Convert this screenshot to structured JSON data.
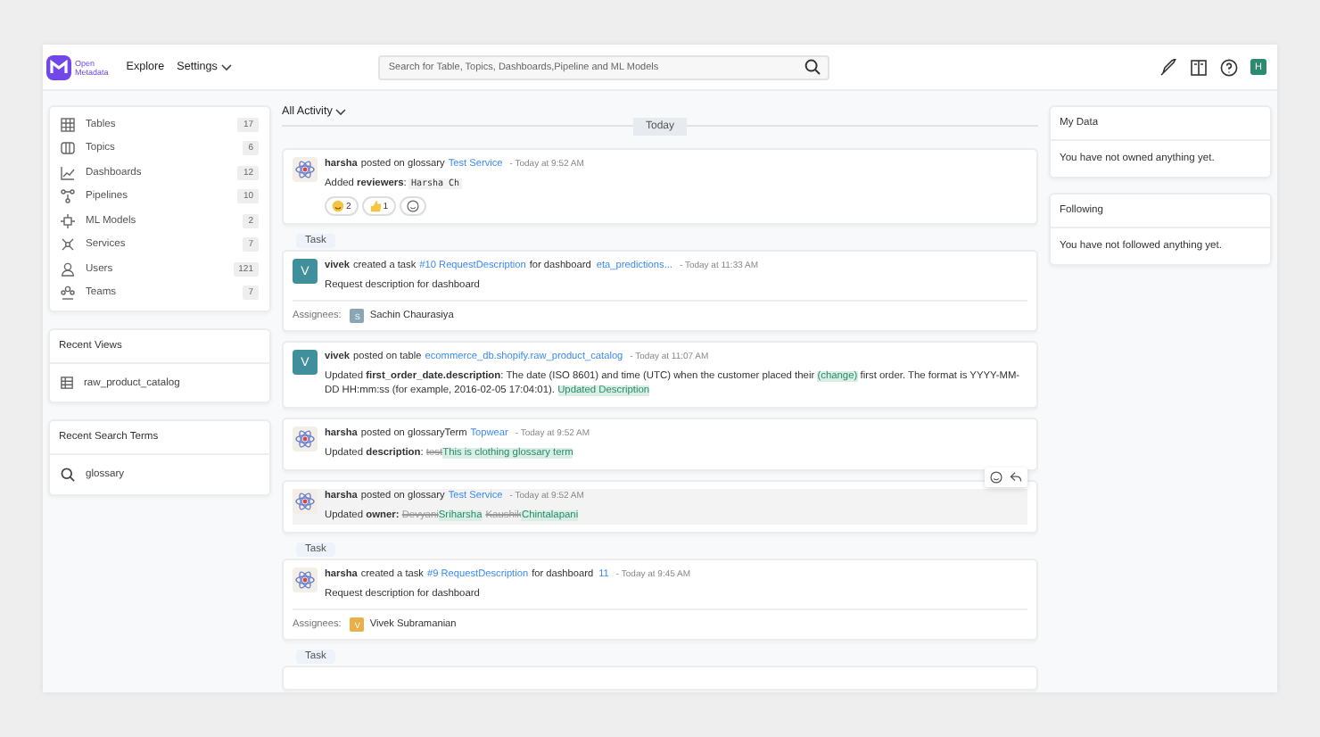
{
  "nav": {
    "logo_text": [
      "Open",
      "Metadata"
    ],
    "links": [
      {
        "label": "Explore",
        "dropdown": false
      },
      {
        "label": "Settings",
        "dropdown": true
      }
    ],
    "search": {
      "placeholder": "Search for Table, Topics, Dashboards,Pipeline and ML Models"
    },
    "user_initial": "H"
  },
  "sidebar": {
    "entities": [
      {
        "label": "Tables",
        "count": "17"
      },
      {
        "label": "Topics",
        "count": "6"
      },
      {
        "label": "Dashboards",
        "count": "12"
      },
      {
        "label": "Pipelines",
        "count": "10"
      },
      {
        "label": "ML Models",
        "count": "2"
      },
      {
        "label": "Services",
        "count": "7"
      },
      {
        "label": "Users",
        "count": "121"
      },
      {
        "label": "Teams",
        "count": "7"
      }
    ],
    "recent_views": {
      "title": "Recent Views",
      "items": [
        "raw_product_catalog"
      ]
    },
    "recent_search": {
      "title": "Recent Search Terms",
      "items": [
        "glossary"
      ]
    }
  },
  "feed": {
    "filter": "All Activity",
    "divider": "Today",
    "items": [
      {
        "kind": "post",
        "hovered": false,
        "avatar": {
          "kind": "logo"
        },
        "author": "harsha",
        "action": "posted on glossary",
        "link": "Test Service",
        "time": "- Today at 9:52 AM",
        "body": [
          {
            "kind": "plain",
            "text": "Added "
          },
          {
            "kind": "bold",
            "text": "reviewers"
          },
          {
            "kind": "plain",
            "text": ": "
          },
          {
            "kind": "code",
            "text": "Harsha Ch"
          }
        ],
        "reactions": [
          {
            "kind": "smile",
            "count": "2"
          },
          {
            "kind": "thumb",
            "count": "1"
          }
        ]
      },
      {
        "kind": "task",
        "badge": "Task",
        "hovered": false,
        "avatar": {
          "kind": "initial",
          "letter": "V",
          "color": "#3f8f9c"
        },
        "author": "vivek",
        "action": "created a task",
        "link": "#10 RequestDescription",
        "extra": "for dashboard",
        "extra_link": "eta_predictions...",
        "time": "- Today at 11:33 AM",
        "body": [
          {
            "kind": "plain",
            "text": "Request description for dashboard"
          }
        ],
        "assignees": {
          "label": "Assignees:",
          "people": [
            {
              "letter": "S",
              "color": "#8aa6b5",
              "name": "Sachin Chaurasiya"
            }
          ]
        }
      },
      {
        "kind": "post",
        "hovered": false,
        "avatar": {
          "kind": "initial",
          "letter": "V",
          "color": "#3f8f9c"
        },
        "author": "vivek",
        "action": "posted on table",
        "link": "ecommerce_db.shopify.raw_product_catalog",
        "time": "- Today at 11:07 AM",
        "body": [
          {
            "kind": "plain",
            "text": "Updated "
          },
          {
            "kind": "bold",
            "text": "first_order_date.description"
          },
          {
            "kind": "plain",
            "text": ": The date (ISO 8601) and time (UTC) when the customer placed their "
          },
          {
            "kind": "ins",
            "text": "(change)"
          },
          {
            "kind": "plain",
            "text": " first order. The format is YYYY-MM-DD HH:mm:ss (for example, 2016-02-05 17:04:01). "
          },
          {
            "kind": "ins",
            "text": "Updated Description"
          }
        ]
      },
      {
        "kind": "post",
        "hovered": false,
        "avatar": {
          "kind": "logo"
        },
        "author": "harsha",
        "action": "posted on glossaryTerm",
        "link": "Topwear",
        "time": "- Today at 9:52 AM",
        "body": [
          {
            "kind": "plain",
            "text": "Updated "
          },
          {
            "kind": "bold",
            "text": "description"
          },
          {
            "kind": "plain",
            "text": ": "
          },
          {
            "kind": "del",
            "text": "test"
          },
          {
            "kind": "ins",
            "text": "This is clothing glossary term"
          }
        ]
      },
      {
        "kind": "post",
        "hovered": true,
        "avatar": {
          "kind": "logo"
        },
        "author": "harsha",
        "action": "posted on glossary",
        "link": "Test Service",
        "time": "- Today at 9:52 AM",
        "body": [
          {
            "kind": "plain",
            "text": "Updated "
          },
          {
            "kind": "bold",
            "text": "owner: "
          },
          {
            "kind": "del",
            "text": "Devyani"
          },
          {
            "kind": "ins",
            "text": "Sriharsha"
          },
          {
            "kind": "del",
            "text": "Kaushik"
          },
          {
            "kind": "ins",
            "text": "Chintalapani"
          }
        ]
      },
      {
        "kind": "task",
        "badge": "Task",
        "hovered": false,
        "avatar": {
          "kind": "logo"
        },
        "author": "harsha",
        "action": "created a task",
        "link": "#9 RequestDescription",
        "extra": "for dashboard",
        "extra_link": "11",
        "time": "- Today at 9:45 AM",
        "body": [
          {
            "kind": "plain",
            "text": "Request description for dashboard"
          }
        ],
        "assignees": {
          "label": "Assignees:",
          "people": [
            {
              "letter": "V",
              "color": "#e8b04a",
              "name": "Vivek Subramanian"
            }
          ]
        }
      },
      {
        "kind": "stub",
        "badge": "Task"
      }
    ]
  },
  "right": {
    "panels": [
      {
        "title": "My Data",
        "text": "You have not owned anything yet."
      },
      {
        "title": "Following",
        "text": "You have not followed anything yet."
      }
    ]
  }
}
